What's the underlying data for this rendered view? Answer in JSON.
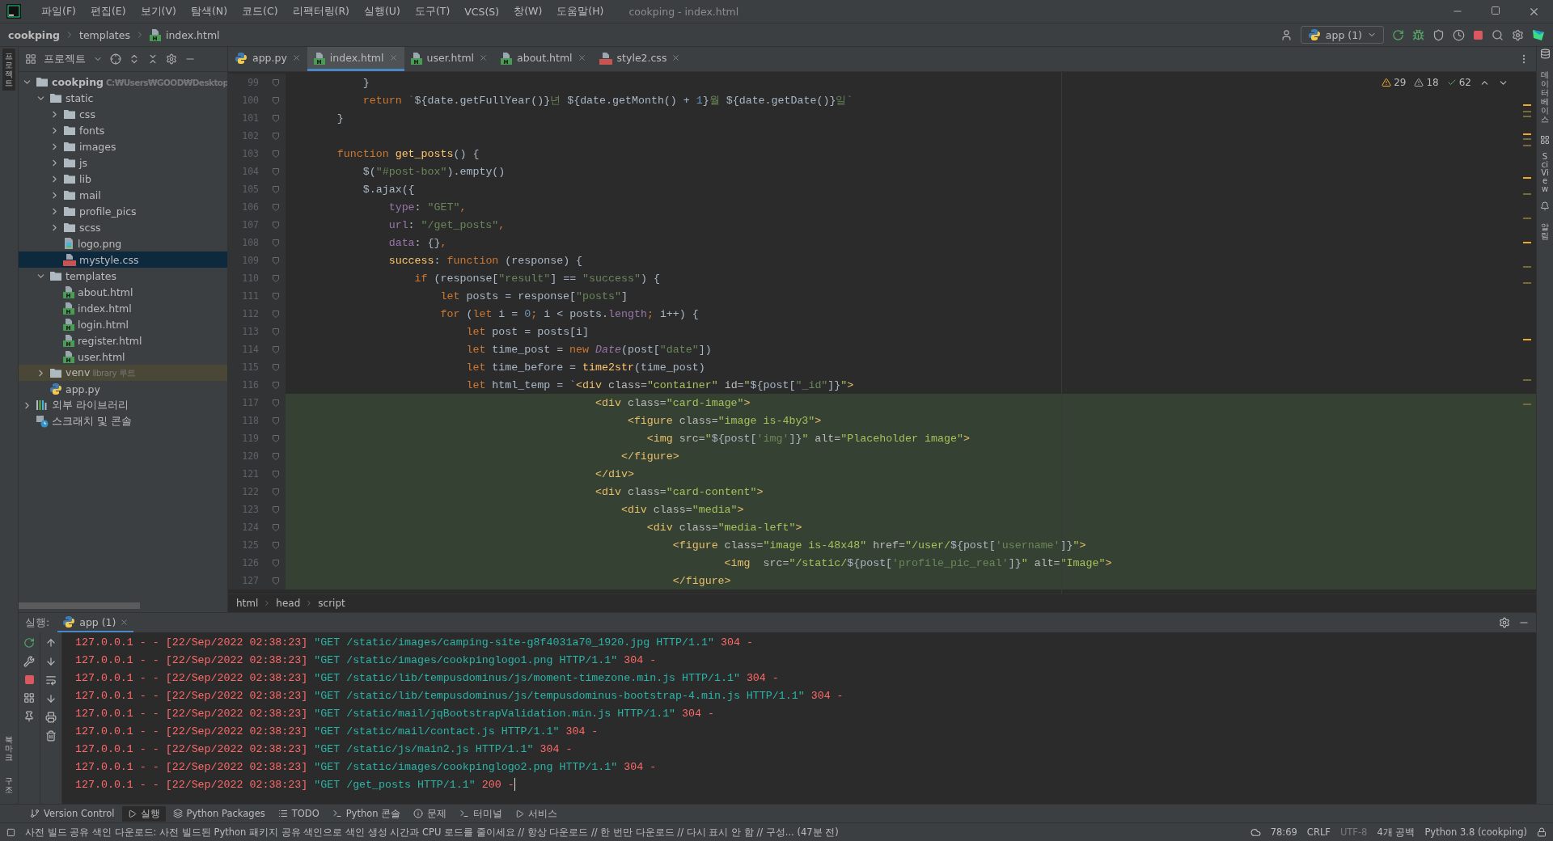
{
  "window": {
    "title": "cookping - index.html"
  },
  "menu": [
    "파일(F)",
    "편집(E)",
    "보기(V)",
    "탐색(N)",
    "코드(C)",
    "리팩터링(R)",
    "실행(U)",
    "도구(T)",
    "VCS(S)",
    "창(W)",
    "도움말(H)"
  ],
  "breadcrumbs": [
    "cookping",
    "templates",
    "index.html"
  ],
  "run_config": "app (1)",
  "left_strip": {
    "top": [
      {
        "label": "프로젝트",
        "selected": true
      }
    ],
    "bottom": [
      {
        "label": "북마크",
        "selected": false
      },
      {
        "label": "구조",
        "selected": false
      }
    ]
  },
  "right_strip": [
    "데이터베이스",
    "SciView",
    "알림"
  ],
  "project_panel": {
    "title": "프로젝트",
    "tree": [
      {
        "label": "cookping",
        "note": "C:₩Users₩GOOD₩Desktop",
        "kind": "folder",
        "expanded": true,
        "selected": false,
        "children": [
          {
            "label": "static",
            "kind": "folder",
            "expanded": true,
            "selected": false,
            "children": [
              {
                "label": "css",
                "kind": "folder",
                "expanded": false,
                "selected": false
              },
              {
                "label": "fonts",
                "kind": "folder",
                "expanded": false,
                "selected": false
              },
              {
                "label": "images",
                "kind": "folder",
                "expanded": false,
                "selected": false
              },
              {
                "label": "js",
                "kind": "folder",
                "expanded": false,
                "selected": false
              },
              {
                "label": "lib",
                "kind": "folder",
                "expanded": false,
                "selected": false
              },
              {
                "label": "mail",
                "kind": "folder",
                "expanded": false,
                "selected": false
              },
              {
                "label": "profile_pics",
                "kind": "folder",
                "expanded": false,
                "selected": false
              },
              {
                "label": "scss",
                "kind": "folder",
                "expanded": false,
                "selected": false
              },
              {
                "label": "logo.png",
                "kind": "image",
                "selected": false
              },
              {
                "label": "mystyle.css",
                "kind": "css",
                "selected": true
              }
            ]
          },
          {
            "label": "templates",
            "kind": "folder",
            "expanded": true,
            "selected": false,
            "children": [
              {
                "label": "about.html",
                "kind": "html",
                "selected": false
              },
              {
                "label": "index.html",
                "kind": "html",
                "selected": false
              },
              {
                "label": "login.html",
                "kind": "html",
                "selected": false
              },
              {
                "label": "register.html",
                "kind": "html",
                "selected": false
              },
              {
                "label": "user.html",
                "kind": "html",
                "selected": false
              }
            ]
          },
          {
            "label": "venv",
            "note": "library 루트",
            "kind": "library_folder",
            "expanded": false,
            "selected": false
          },
          {
            "label": "app.py",
            "kind": "python",
            "selected": false
          }
        ]
      },
      {
        "label": "외부 라이브러리",
        "kind": "libraries",
        "expanded": false,
        "selected": false
      },
      {
        "label": "스크래치 및 콘솔",
        "kind": "scratch",
        "selected": false
      }
    ]
  },
  "editor_tabs": [
    {
      "label": "app.py",
      "kind": "python",
      "selected": false
    },
    {
      "label": "index.html",
      "kind": "html",
      "selected": true
    },
    {
      "label": "user.html",
      "kind": "html",
      "selected": false
    },
    {
      "label": "about.html",
      "kind": "html",
      "selected": false
    },
    {
      "label": "style2.css",
      "kind": "css",
      "selected": false
    }
  ],
  "inspections": {
    "warnings": "29",
    "weak_warnings": "18",
    "typos": "62"
  },
  "code_lines": [
    {
      "number": "99",
      "highlighted": false,
      "tokens": [
        {
          "kind": "plain",
          "text": "            }"
        }
      ]
    },
    {
      "number": "100",
      "highlighted": false,
      "tokens": [
        {
          "kind": "keyword",
          "text": "            return"
        },
        {
          "kind": "string",
          "text": " `"
        },
        {
          "kind": "plain",
          "text": "${date.getFullYear()}"
        },
        {
          "kind": "string",
          "text": "년 "
        },
        {
          "kind": "plain",
          "text": "${date.getMonth() + "
        },
        {
          "kind": "number",
          "text": "1"
        },
        {
          "kind": "plain",
          "text": "}"
        },
        {
          "kind": "string",
          "text": "월 "
        },
        {
          "kind": "plain",
          "text": "${date.getDate()}"
        },
        {
          "kind": "string",
          "text": "일`"
        }
      ]
    },
    {
      "number": "101",
      "highlighted": false,
      "tokens": [
        {
          "kind": "plain",
          "text": "        }"
        }
      ]
    },
    {
      "number": "102",
      "highlighted": false
    },
    {
      "number": "103",
      "highlighted": false,
      "tokens": [
        {
          "kind": "keyword",
          "text": "        function"
        },
        {
          "kind": "function",
          "text": " get_posts"
        },
        {
          "kind": "plain",
          "text": "() {"
        }
      ]
    },
    {
      "number": "104",
      "highlighted": false,
      "tokens": [
        {
          "kind": "plain",
          "text": "            $("
        },
        {
          "kind": "string",
          "text": "\"#post-box\""
        },
        {
          "kind": "plain",
          "text": ").empty()"
        }
      ]
    },
    {
      "number": "105",
      "highlighted": false,
      "tokens": [
        {
          "kind": "plain",
          "text": "            $.ajax({"
        }
      ]
    },
    {
      "number": "106",
      "highlighted": false,
      "tokens": [
        {
          "kind": "property",
          "text": "                type"
        },
        {
          "kind": "plain",
          "text": ": "
        },
        {
          "kind": "string",
          "text": "\"GET\""
        },
        {
          "kind": "keyword",
          "text": ","
        }
      ]
    },
    {
      "number": "107",
      "highlighted": false,
      "tokens": [
        {
          "kind": "property",
          "text": "                url"
        },
        {
          "kind": "plain",
          "text": ": "
        },
        {
          "kind": "string",
          "text": "\"/get_posts\""
        },
        {
          "kind": "keyword",
          "text": ","
        }
      ]
    },
    {
      "number": "108",
      "highlighted": false,
      "tokens": [
        {
          "kind": "property",
          "text": "                data"
        },
        {
          "kind": "plain",
          "text": ": {}"
        },
        {
          "kind": "keyword",
          "text": ","
        }
      ]
    },
    {
      "number": "109",
      "highlighted": false,
      "tokens": [
        {
          "kind": "function",
          "text": "                success"
        },
        {
          "kind": "plain",
          "text": ": "
        },
        {
          "kind": "keyword",
          "text": "function"
        },
        {
          "kind": "plain",
          "text": " (response) {"
        }
      ]
    },
    {
      "number": "110",
      "highlighted": false,
      "tokens": [
        {
          "kind": "keyword",
          "text": "                    if"
        },
        {
          "kind": "plain",
          "text": " (response["
        },
        {
          "kind": "string",
          "text": "\"result\""
        },
        {
          "kind": "plain",
          "text": "] == "
        },
        {
          "kind": "string",
          "text": "\"success\""
        },
        {
          "kind": "plain",
          "text": ") {"
        }
      ]
    },
    {
      "number": "111",
      "highlighted": false,
      "tokens": [
        {
          "kind": "keyword",
          "text": "                        let"
        },
        {
          "kind": "plain",
          "text": " posts = response["
        },
        {
          "kind": "string",
          "text": "\"posts\""
        },
        {
          "kind": "plain",
          "text": "]"
        }
      ]
    },
    {
      "number": "112",
      "highlighted": false,
      "tokens": [
        {
          "kind": "keyword",
          "text": "                        for"
        },
        {
          "kind": "plain",
          "text": " ("
        },
        {
          "kind": "keyword",
          "text": "let"
        },
        {
          "kind": "plain",
          "text": " i = "
        },
        {
          "kind": "number",
          "text": "0"
        },
        {
          "kind": "keyword",
          "text": ";"
        },
        {
          "kind": "plain",
          "text": " i < posts."
        },
        {
          "kind": "property",
          "text": "length"
        },
        {
          "kind": "keyword",
          "text": ";"
        },
        {
          "kind": "plain",
          "text": " i++) {"
        }
      ]
    },
    {
      "number": "113",
      "highlighted": false,
      "tokens": [
        {
          "kind": "keyword",
          "text": "                            let"
        },
        {
          "kind": "plain",
          "text": " post = posts[i]"
        }
      ]
    },
    {
      "number": "114",
      "highlighted": false,
      "tokens": [
        {
          "kind": "keyword",
          "text": "                            let"
        },
        {
          "kind": "plain",
          "text": " time_post = "
        },
        {
          "kind": "keyword",
          "text": "new"
        },
        {
          "kind": "class",
          "text": " Date"
        },
        {
          "kind": "plain",
          "text": "(post["
        },
        {
          "kind": "string",
          "text": "\"date\""
        },
        {
          "kind": "plain",
          "text": "])"
        }
      ]
    },
    {
      "number": "115",
      "highlighted": false,
      "tokens": [
        {
          "kind": "keyword",
          "text": "                            let"
        },
        {
          "kind": "plain",
          "text": " time_before = "
        },
        {
          "kind": "function",
          "text": "time2str"
        },
        {
          "kind": "plain",
          "text": "(time_post)"
        }
      ]
    },
    {
      "number": "116",
      "highlighted": false,
      "tokens": [
        {
          "kind": "keyword",
          "text": "                            let"
        },
        {
          "kind": "plain",
          "text": " html_temp = "
        },
        {
          "kind": "inject",
          "text": "`"
        },
        {
          "kind": "tag",
          "text": "<div "
        },
        {
          "kind": "attr",
          "text": "class="
        },
        {
          "kind": "value",
          "text": "\"container\""
        },
        {
          "kind": "attr",
          "text": " id="
        },
        {
          "kind": "value",
          "text": "\""
        },
        {
          "kind": "inject",
          "text": "${post["
        },
        {
          "kind": "string",
          "text": "\"_id\""
        },
        {
          "kind": "inject",
          "text": "]}"
        },
        {
          "kind": "value",
          "text": "\""
        },
        {
          "kind": "tag",
          "text": ">"
        }
      ]
    },
    {
      "number": "117",
      "highlighted": true,
      "tokens": [
        {
          "kind": "tag",
          "text": "                                                <div "
        },
        {
          "kind": "attr",
          "text": "class="
        },
        {
          "kind": "value",
          "text": "\"card-image\""
        },
        {
          "kind": "tag",
          "text": ">"
        }
      ]
    },
    {
      "number": "118",
      "highlighted": true,
      "tokens": [
        {
          "kind": "tag",
          "text": "                                                     <figure "
        },
        {
          "kind": "attr",
          "text": "class="
        },
        {
          "kind": "value",
          "text": "\"image is-4by3\""
        },
        {
          "kind": "tag",
          "text": ">"
        }
      ]
    },
    {
      "number": "119",
      "highlighted": true,
      "tokens": [
        {
          "kind": "tag",
          "text": "                                                        <img "
        },
        {
          "kind": "attr",
          "text": "src="
        },
        {
          "kind": "value",
          "text": "\""
        },
        {
          "kind": "inject",
          "text": "${post["
        },
        {
          "kind": "string",
          "text": "'img'"
        },
        {
          "kind": "inject",
          "text": "]}"
        },
        {
          "kind": "value",
          "text": "\""
        },
        {
          "kind": "attr",
          "text": " alt="
        },
        {
          "kind": "value",
          "text": "\"Placeholder image\""
        },
        {
          "kind": "tag",
          "text": ">"
        }
      ]
    },
    {
      "number": "120",
      "highlighted": true,
      "tokens": [
        {
          "kind": "tag",
          "text": "                                                    </figure>"
        }
      ]
    },
    {
      "number": "121",
      "highlighted": true,
      "tokens": [
        {
          "kind": "tag",
          "text": "                                                </div>"
        }
      ]
    },
    {
      "number": "122",
      "highlighted": true,
      "tokens": [
        {
          "kind": "tag",
          "text": "                                                <div "
        },
        {
          "kind": "attr",
          "text": "class="
        },
        {
          "kind": "value",
          "text": "\"card-content\""
        },
        {
          "kind": "tag",
          "text": ">"
        }
      ]
    },
    {
      "number": "123",
      "highlighted": true,
      "tokens": [
        {
          "kind": "tag",
          "text": "                                                    <div "
        },
        {
          "kind": "attr",
          "text": "class="
        },
        {
          "kind": "value",
          "text": "\"media\""
        },
        {
          "kind": "tag",
          "text": ">"
        }
      ]
    },
    {
      "number": "124",
      "highlighted": true,
      "tokens": [
        {
          "kind": "tag",
          "text": "                                                        <div "
        },
        {
          "kind": "attr",
          "text": "class="
        },
        {
          "kind": "value",
          "text": "\"media-left\""
        },
        {
          "kind": "tag",
          "text": ">"
        }
      ]
    },
    {
      "number": "125",
      "highlighted": true,
      "tokens": [
        {
          "kind": "tag",
          "text": "                                                            <figure "
        },
        {
          "kind": "attr",
          "text": "class="
        },
        {
          "kind": "value",
          "text": "\"image is-48x48\""
        },
        {
          "kind": "attr",
          "text": " href="
        },
        {
          "kind": "value",
          "text": "\"/user/"
        },
        {
          "kind": "inject",
          "text": "${post["
        },
        {
          "kind": "string",
          "text": "'username'"
        },
        {
          "kind": "inject",
          "text": "]}"
        },
        {
          "kind": "value",
          "text": "\""
        },
        {
          "kind": "tag",
          "text": ">"
        }
      ]
    },
    {
      "number": "126",
      "highlighted": true,
      "tokens": [
        {
          "kind": "tag",
          "text": "                                                                    <img  "
        },
        {
          "kind": "attr",
          "text": "src="
        },
        {
          "kind": "value",
          "text": "\"/static/"
        },
        {
          "kind": "inject",
          "text": "${post["
        },
        {
          "kind": "string",
          "text": "'profile_pic_real'"
        },
        {
          "kind": "inject",
          "text": "]}"
        },
        {
          "kind": "value",
          "text": "\""
        },
        {
          "kind": "attr",
          "text": " alt="
        },
        {
          "kind": "value",
          "text": "\"Image\""
        },
        {
          "kind": "tag",
          "text": ">"
        }
      ]
    },
    {
      "number": "127",
      "highlighted": true,
      "tokens": [
        {
          "kind": "tag",
          "text": "                                                            </figure>"
        }
      ]
    }
  ],
  "editor_path": [
    "html",
    "head",
    "script"
  ],
  "run_panel": {
    "label": "실행:",
    "tab": "app (1)",
    "lines": [
      {
        "prefix": "127.0.0.1 - - [22/Sep/2022 02:38:23] ",
        "request": "\"GET /static/images/camping-site-g8f4031a70_1920.jpg HTTP/1.1\"",
        "status": " 304 -"
      },
      {
        "prefix": "127.0.0.1 - - [22/Sep/2022 02:38:23] ",
        "request": "\"GET /static/images/cookpinglogo1.png HTTP/1.1\"",
        "status": " 304 -"
      },
      {
        "prefix": "127.0.0.1 - - [22/Sep/2022 02:38:23] ",
        "request": "\"GET /static/lib/tempusdominus/js/moment-timezone.min.js HTTP/1.1\"",
        "status": " 304 -"
      },
      {
        "prefix": "127.0.0.1 - - [22/Sep/2022 02:38:23] ",
        "request": "\"GET /static/lib/tempusdominus/js/tempusdominus-bootstrap-4.min.js HTTP/1.1\"",
        "status": " 304 -"
      },
      {
        "prefix": "127.0.0.1 - - [22/Sep/2022 02:38:23] ",
        "request": "\"GET /static/mail/jqBootstrapValidation.min.js HTTP/1.1\"",
        "status": " 304 -"
      },
      {
        "prefix": "127.0.0.1 - - [22/Sep/2022 02:38:23] ",
        "request": "\"GET /static/mail/contact.js HTTP/1.1\"",
        "status": " 304 -"
      },
      {
        "prefix": "127.0.0.1 - - [22/Sep/2022 02:38:23] ",
        "request": "\"GET /static/js/main2.js HTTP/1.1\"",
        "status": " 304 -"
      },
      {
        "prefix": "127.0.0.1 - - [22/Sep/2022 02:38:23] ",
        "request": "\"GET /static/images/cookpinglogo2.png HTTP/1.1\"",
        "status": " 304 -"
      },
      {
        "prefix": "127.0.0.1 - - [22/Sep/2022 02:38:23] ",
        "request": "\"GET /get_posts HTTP/1.1\"",
        "status": " 200 -"
      }
    ]
  },
  "tool_tabs": [
    {
      "label": "Version Control",
      "kind": "vcs",
      "selected": false
    },
    {
      "label": "실행",
      "kind": "run",
      "selected": true
    },
    {
      "label": "Python Packages",
      "kind": "packages",
      "selected": false
    },
    {
      "label": "TODO",
      "kind": "todo",
      "selected": false
    },
    {
      "label": "Python 콘솔",
      "kind": "console",
      "selected": false
    },
    {
      "label": "문제",
      "kind": "problems",
      "selected": false
    },
    {
      "label": "터미널",
      "kind": "terminal",
      "selected": false
    },
    {
      "label": "서비스",
      "kind": "services",
      "selected": false
    }
  ],
  "status_bar": {
    "message": "사전 빌드 공유 색인 다운로드: 사전 빌드된 Python 패키지 공유 색인으로 색인 생성 시간과 CPU 로드를 줄이세요 // 항상 다운로드 // 한 번만 다운로드 // 다시 표시 안 함 // 구성... (47분 전)",
    "position": "78:69",
    "line_separator": "CRLF",
    "encoding": "UTF-8",
    "indent": "4개 공백",
    "interpreter": "Python 3.8 (cookping)"
  }
}
